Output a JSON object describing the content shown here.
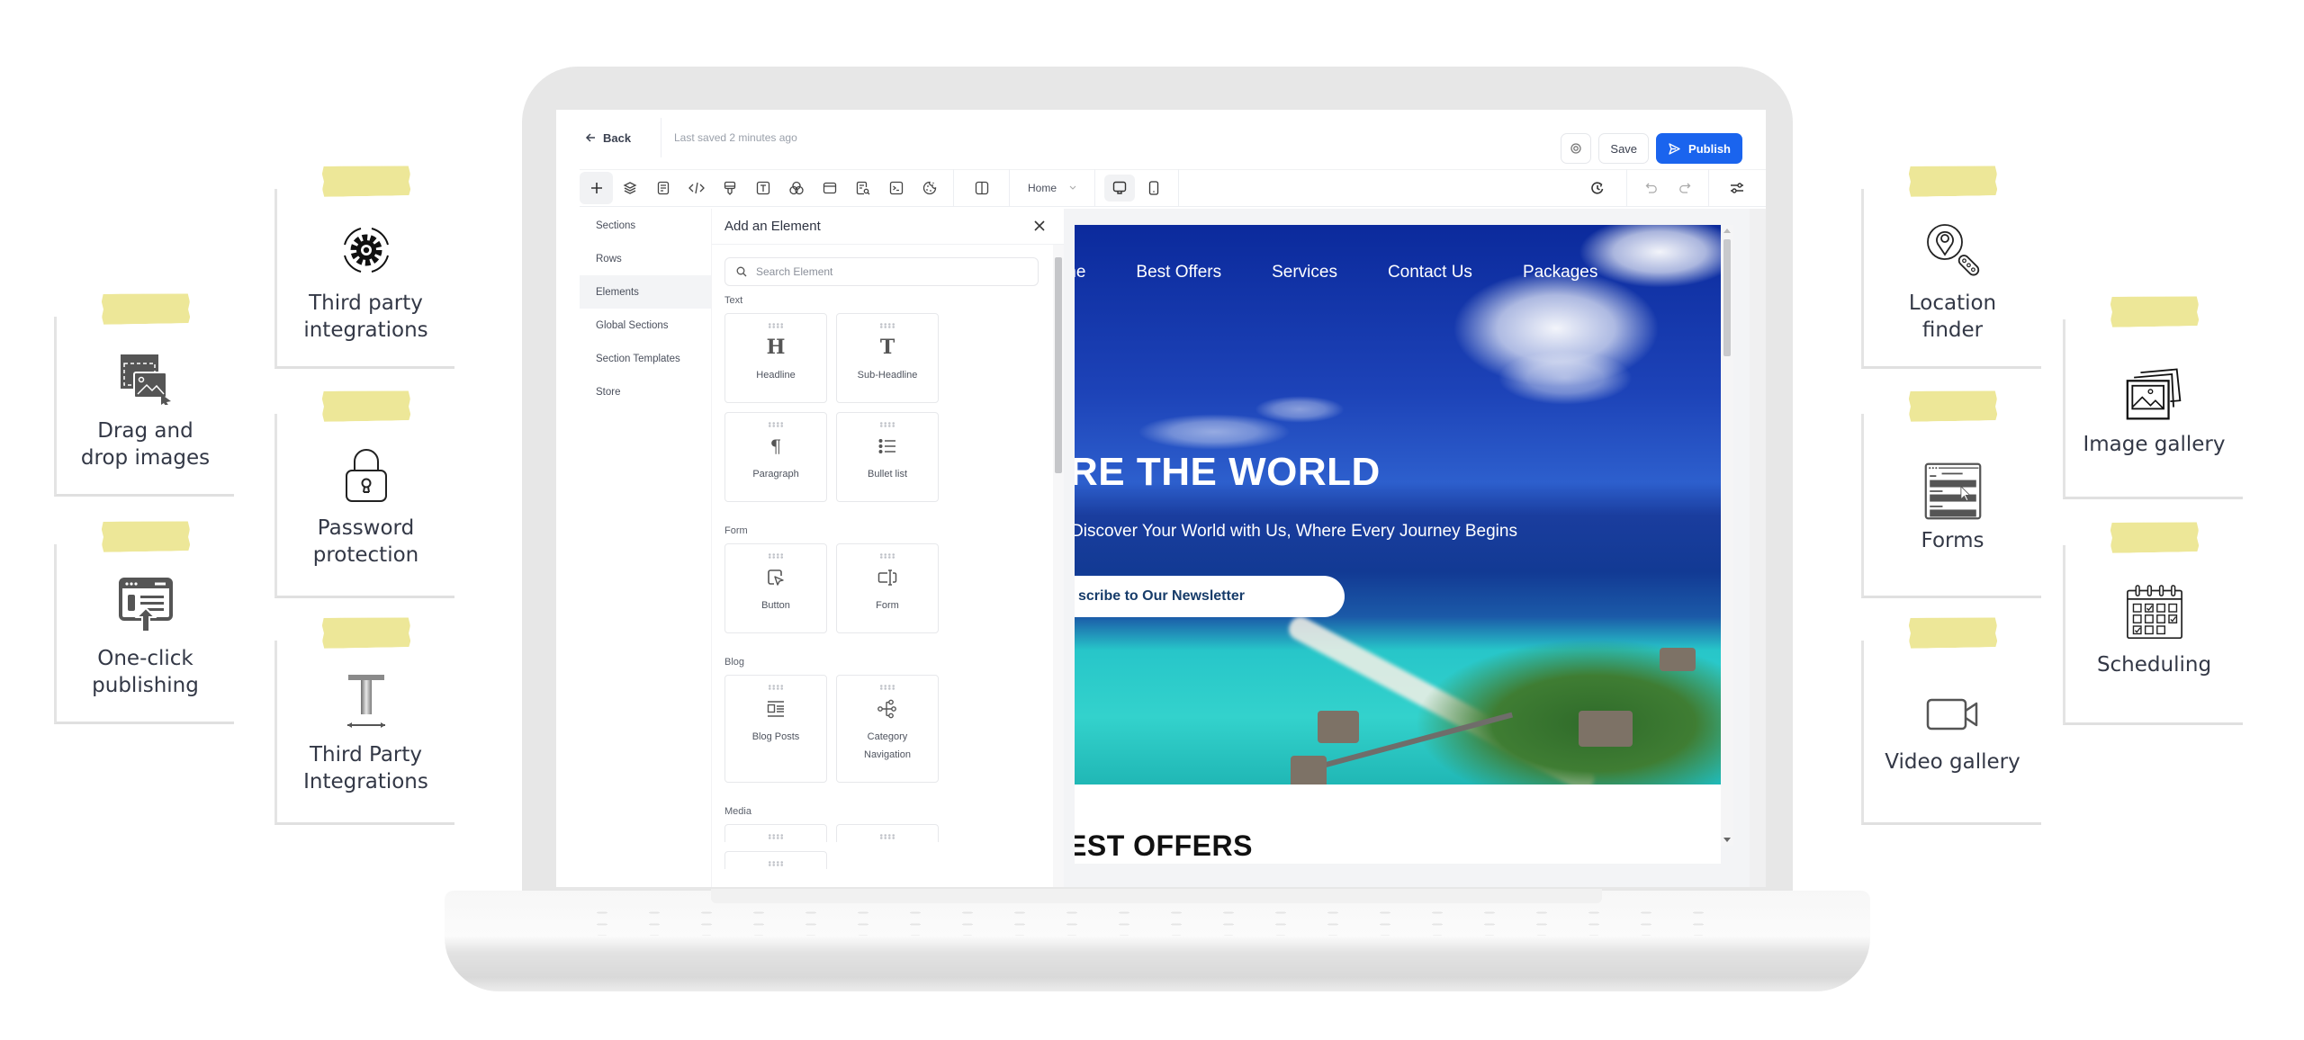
{
  "editor": {
    "back_label": "Back",
    "last_saved": "Last saved 2 minutes ago",
    "save_label": "Save",
    "publish_label": "Publish",
    "page_select": "Home",
    "toolbar_icons": [
      "add-icon",
      "layers-icon",
      "page-icon",
      "code-icon",
      "brush-icon",
      "text-style-icon",
      "colors-icon",
      "browser-icon",
      "page-search-icon",
      "terminal-icon",
      "cookie-icon",
      "split-view-icon"
    ],
    "left_nav": [
      {
        "label": "Sections",
        "active": false
      },
      {
        "label": "Rows",
        "active": false
      },
      {
        "label": "Elements",
        "active": true
      },
      {
        "label": "Global Sections",
        "active": false
      },
      {
        "label": "Section Templates",
        "active": false
      },
      {
        "label": "Store",
        "active": false
      }
    ],
    "panel": {
      "title": "Add an Element",
      "search_placeholder": "Search Element",
      "categories": [
        {
          "name": "Text",
          "items": [
            "Headline",
            "Sub-Headline",
            "Paragraph",
            "Bullet list"
          ]
        },
        {
          "name": "Form",
          "items": [
            "Button",
            "Form"
          ]
        },
        {
          "name": "Blog",
          "items": [
            "Blog Posts",
            "Category Navigation"
          ]
        },
        {
          "name": "Media",
          "items": []
        }
      ]
    }
  },
  "site": {
    "nav": [
      "me",
      "Best Offers",
      "Services",
      "Contact Us",
      "Packages"
    ],
    "hero_title": "RE THE WORLD",
    "hero_subtitle": "Discover Your World with Us, Where Every Journey Begins",
    "cta": "scribe to Our Newsletter",
    "section_title": "EST OFFERS"
  },
  "features": {
    "left": [
      {
        "label": "Drag and drop images",
        "icon": "drag-drop-image-icon"
      },
      {
        "label": "One-click publishing",
        "icon": "publish-upload-icon"
      },
      {
        "label": "Third party integrations",
        "icon": "gear-cycle-icon"
      },
      {
        "label": "Password protection",
        "icon": "padlock-icon"
      },
      {
        "label": "Third Party Integrations",
        "icon": "text-width-icon"
      }
    ],
    "right": [
      {
        "label": "Location finder",
        "icon": "location-search-icon"
      },
      {
        "label": "Forms",
        "icon": "form-icon"
      },
      {
        "label": "Video gallery",
        "icon": "video-camera-icon"
      },
      {
        "label": "Image gallery",
        "icon": "image-stack-icon"
      },
      {
        "label": "Scheduling",
        "icon": "calendar-icon"
      }
    ]
  },
  "colors": {
    "primary": "#1a64ee",
    "tape": "#ece58f"
  }
}
